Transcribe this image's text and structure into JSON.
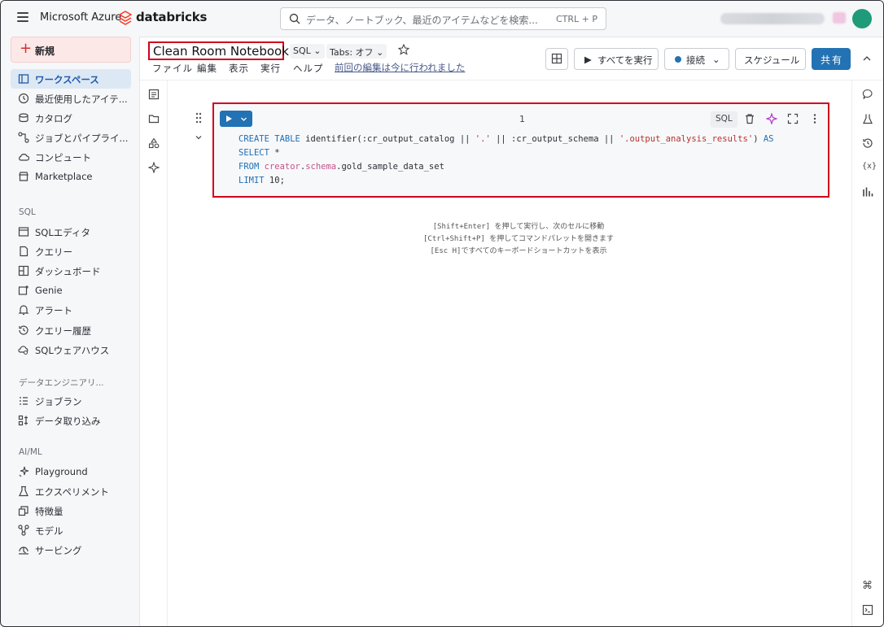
{
  "topbar": {
    "brand_ms": "Microsoft Azure",
    "brand_db": "databricks",
    "search_placeholder": "データ、ノートブック、最近のアイテムなどを検索...",
    "search_shortcut": "CTRL + P"
  },
  "sidebar": {
    "new_label": "新規",
    "items": [
      {
        "label": "ワークスペース",
        "icon": "workspace-icon",
        "active": true
      },
      {
        "label": "最近使用したアイテ...",
        "icon": "clock-icon"
      },
      {
        "label": "カタログ",
        "icon": "catalog-icon"
      },
      {
        "label": "ジョブとパイプライ...",
        "icon": "workflow-icon"
      },
      {
        "label": "コンピュート",
        "icon": "cloud-icon"
      },
      {
        "label": "Marketplace",
        "icon": "store-icon"
      }
    ],
    "sql_section": "SQL",
    "sql_items": [
      {
        "label": "SQLエディタ",
        "icon": "sql-editor-icon"
      },
      {
        "label": "クエリー",
        "icon": "query-icon"
      },
      {
        "label": "ダッシュボード",
        "icon": "dashboard-icon"
      },
      {
        "label": "Genie",
        "icon": "genie-icon"
      },
      {
        "label": "アラート",
        "icon": "bell-icon"
      },
      {
        "label": "クエリー履歴",
        "icon": "history-icon"
      },
      {
        "label": "SQLウェアハウス",
        "icon": "warehouse-icon"
      }
    ],
    "de_section": "データエンジニアリ...",
    "de_items": [
      {
        "label": "ジョブラン",
        "icon": "job-runs-icon"
      },
      {
        "label": "データ取り込み",
        "icon": "ingest-icon"
      }
    ],
    "ml_section": "AI/ML",
    "ml_items": [
      {
        "label": "Playground",
        "icon": "playground-icon"
      },
      {
        "label": "エクスペリメント",
        "icon": "flask-icon"
      },
      {
        "label": "特徴量",
        "icon": "features-icon"
      },
      {
        "label": "モデル",
        "icon": "models-icon"
      },
      {
        "label": "サービング",
        "icon": "serving-icon"
      }
    ]
  },
  "notebook": {
    "title": "Clean Room Notebook",
    "lang_chip": "SQL",
    "tabs_chip": "Tabs: オフ",
    "menu": [
      "ファイル",
      "編集",
      "表示",
      "実行",
      "ヘルプ"
    ],
    "last_edit": "前回の編集は今に行われました",
    "run_all": "すべてを実行",
    "connect": "接続",
    "schedule": "スケジュール",
    "share": "共有"
  },
  "cell": {
    "number": "1",
    "lang": "SQL",
    "code": {
      "line1": {
        "create": "CREATE TABLE",
        "fn": " identifier(:cr_output_catalog || ",
        "dot": "'.'",
        "mid": " || :cr_output_schema || ",
        "tbl": "'.output_analysis_results'",
        "close": ") ",
        "as": "AS"
      },
      "line2": {
        "select": "SELECT",
        "star": " *"
      },
      "line3": {
        "from": "FROM",
        "creator": " creator",
        "d1": ".",
        "schema": "schema",
        "rest": ".gold_sample_data_set"
      },
      "line4": {
        "limit": "LIMIT",
        "num": " 10;"
      }
    }
  },
  "hints": [
    "[Shift+Enter] を押して実行し、次のセルに移動",
    "[Ctrl+Shift+P] を押してコマンドパレットを開きます",
    "[Esc H]ですべてのキーボードショートカットを表示"
  ],
  "colors": {
    "accent": "#2272b4",
    "highlight": "#d0021b",
    "keyword": "#1f6fb5",
    "string": "#b5302c"
  }
}
